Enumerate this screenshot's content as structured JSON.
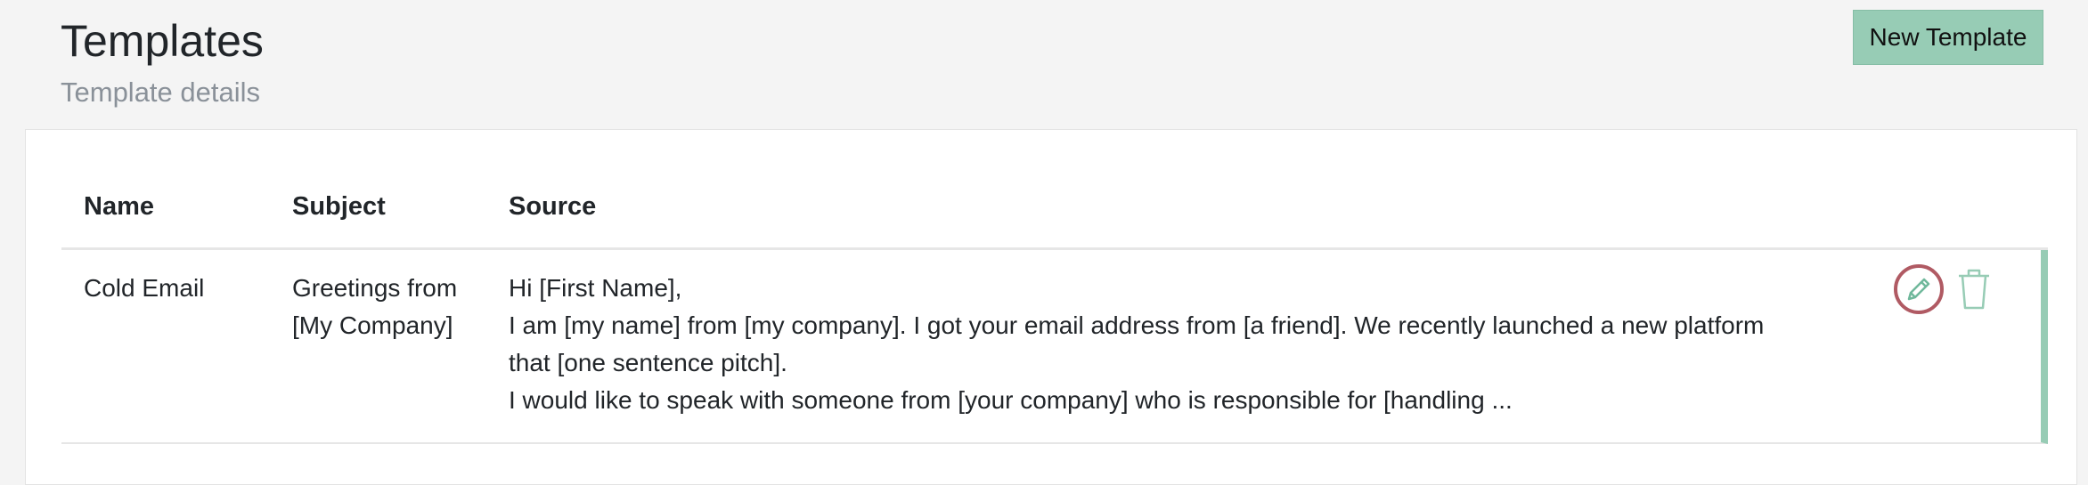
{
  "header": {
    "title": "Templates",
    "subtitle": "Template details",
    "new_template_label": "New Template"
  },
  "table": {
    "columns": [
      "Name",
      "Subject",
      "Source"
    ],
    "rows": [
      {
        "name": "Cold Email",
        "subject_lines": [
          "Greetings from",
          "[My Company]"
        ],
        "source_lines": [
          "Hi [First Name],",
          "I am [my name] from [my company]. I got your email address from [a friend]. We recently launched a new platform",
          "that [one sentence pitch].",
          "I would like to speak with someone from [your company] who is responsible for [handling ..."
        ],
        "actions": {
          "edit_icon": "pencil-icon",
          "delete_icon": "trash-icon"
        }
      }
    ]
  },
  "colors": {
    "accent": "#97ccb5",
    "edit_ring": "#b05a63",
    "background": "#f4f4f4"
  }
}
